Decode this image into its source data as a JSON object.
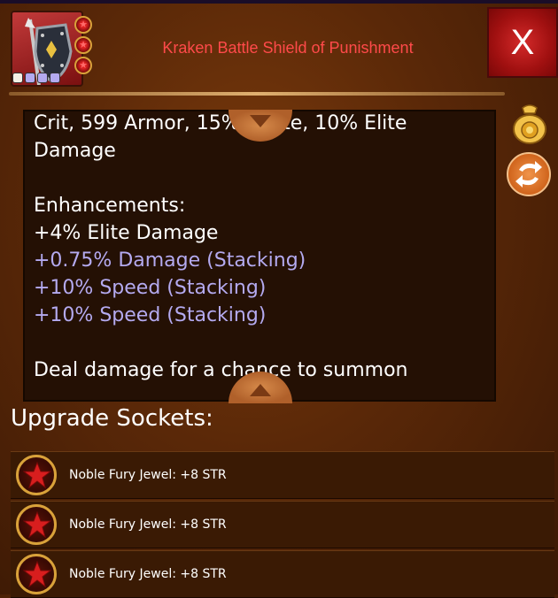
{
  "item": {
    "name": "Kraken Battle Shield of Punishment",
    "icon": "battle-shield-icon",
    "rank_stars": 3,
    "tier_pips": [
      "#f4f0e6",
      "#b4aaf0",
      "#b4aaf0",
      "#b4aaf0"
    ]
  },
  "window": {
    "close_label": "X"
  },
  "description": {
    "lines_cut_top": "Crit, 599 Armor, 15% Haste, 10% Elite",
    "line_damage": "Damage",
    "enhancements_header": "Enhancements:",
    "enhancements": [
      {
        "text": "+4% Elite Damage",
        "color": "white"
      },
      {
        "text": "+0.75% Damage (Stacking)",
        "color": "blue"
      },
      {
        "text": "+10% Speed (Stacking)",
        "color": "blue"
      },
      {
        "text": "+10% Speed (Stacking)",
        "color": "blue"
      }
    ],
    "effect_cut_bottom": "Deal damage for a chance to summon"
  },
  "side_actions": {
    "gold_icon": "gold-bag-icon",
    "swap_icon": "swap-arrows-icon"
  },
  "sockets": {
    "title": "Upgrade Sockets:",
    "items": [
      {
        "label": "Noble Fury Jewel: +8 STR"
      },
      {
        "label": "Noble Fury Jewel: +8 STR"
      },
      {
        "label": "Noble Fury Jewel: +8 STR"
      }
    ]
  },
  "colors": {
    "title_red": "#ff4a4a",
    "stat_blue": "#b4aaf0",
    "close_red": "#c41e1e",
    "gold": "#d9a23a"
  }
}
